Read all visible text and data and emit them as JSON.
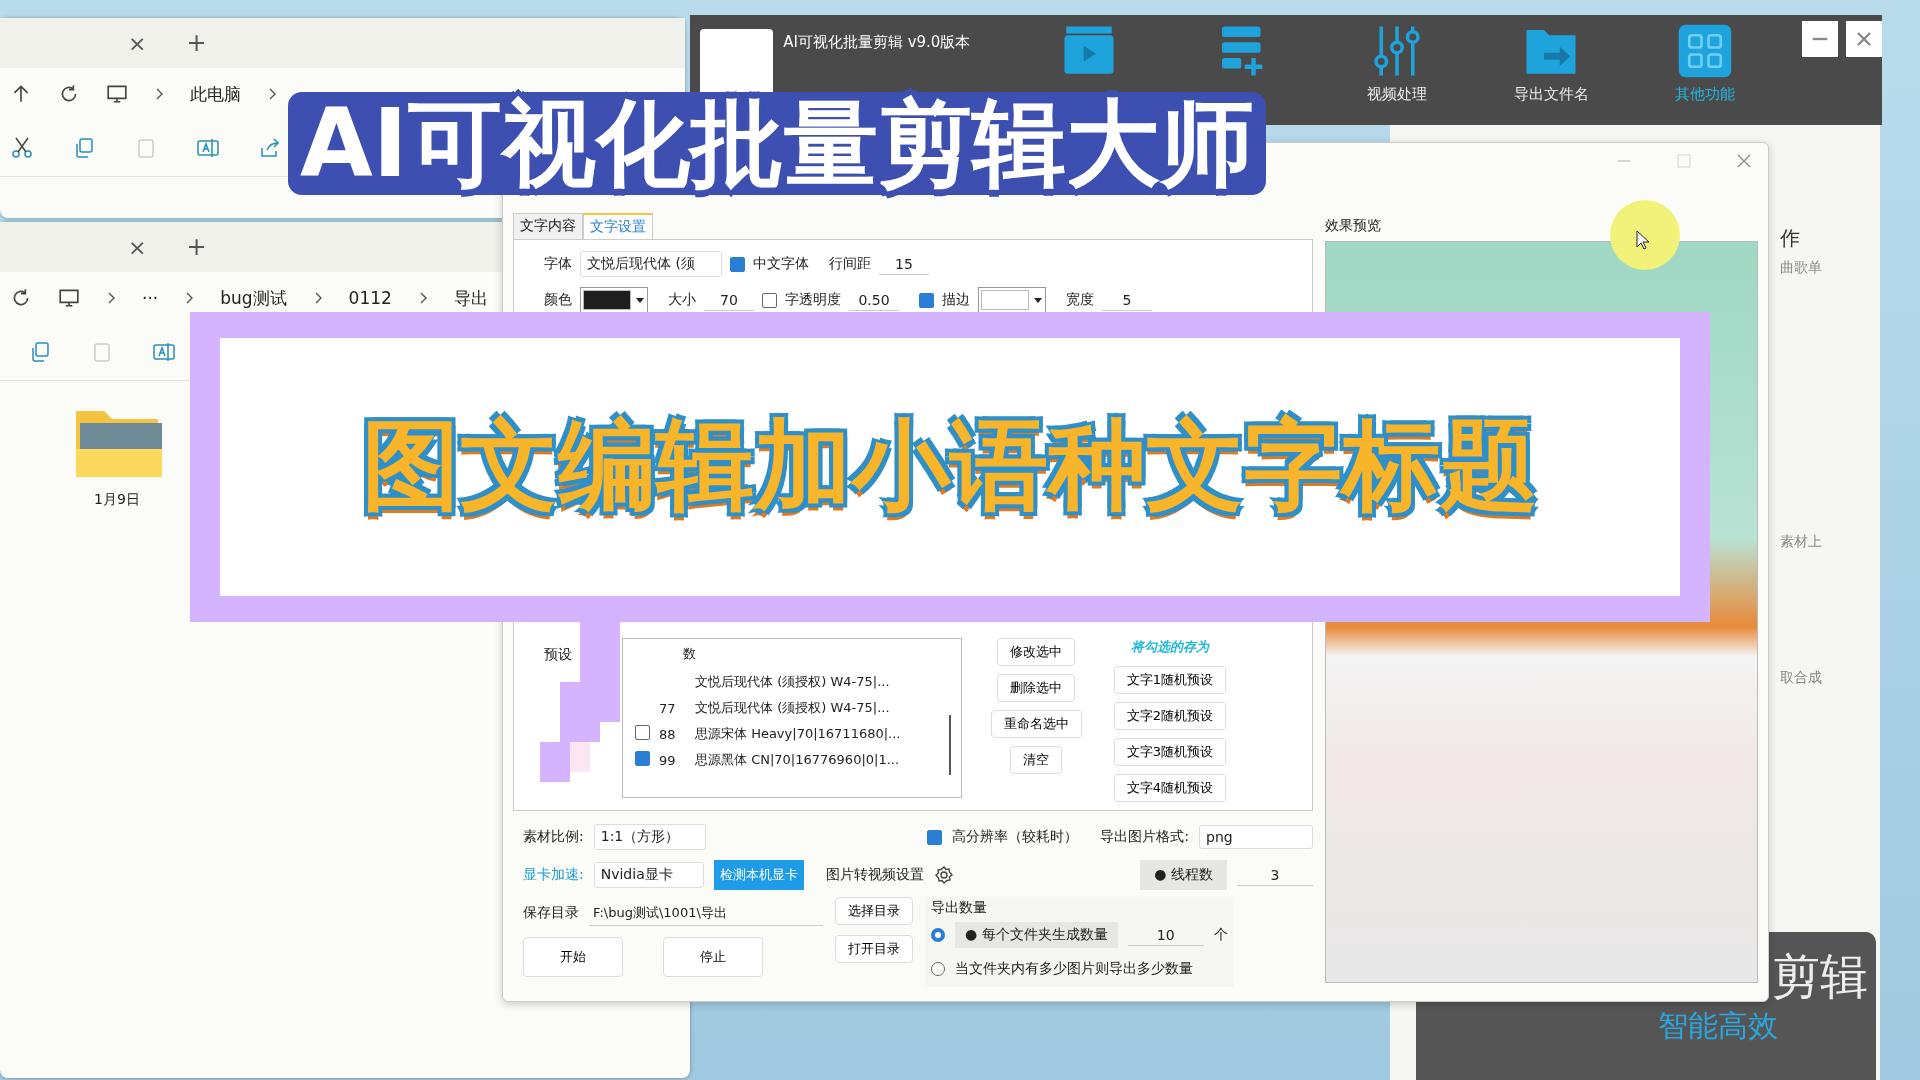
{
  "explorers": [
    {
      "close_tab": "×",
      "new_tab": "+",
      "nav": [
        {
          "kind": "up"
        },
        {
          "kind": "refresh"
        },
        {
          "kind": "pc"
        }
      ],
      "path": [
        "此电脑"
      ],
      "toolbar": [
        {
          "kind": "cut"
        },
        {
          "kind": "copy"
        },
        {
          "kind": "paste"
        },
        {
          "kind": "rename"
        },
        {
          "kind": "share"
        }
      ]
    },
    {
      "close_tab": "×",
      "new_tab": "+",
      "nav": [
        {
          "kind": "refresh"
        },
        {
          "kind": "pc"
        }
      ],
      "path": [
        "···",
        "bug测试",
        "0112",
        "导出"
      ],
      "toolbar": [
        {
          "kind": "copy"
        },
        {
          "kind": "paste"
        },
        {
          "kind": "rename"
        }
      ],
      "items": [
        {
          "label": "1月9日"
        }
      ]
    }
  ],
  "app": {
    "title": "AI可视化批量剪辑 v9.0版本",
    "tools": [
      {
        "kind": "clapper",
        "selected": false
      },
      {
        "kind": "list-add",
        "selected": false
      },
      {
        "kind": "sliders",
        "label": "视频处理",
        "selected": false
      },
      {
        "kind": "folder",
        "label": "导出文件名",
        "selected": false
      },
      {
        "kind": "grid",
        "label": "其他功能",
        "selected": true
      }
    ],
    "side_texts": [
      "作",
      "曲歌单",
      "素材上",
      "取合成"
    ],
    "promo": {
      "title": "剪辑",
      "subtitle": "智能高效"
    }
  },
  "dialog": {
    "tabs": [
      {
        "label": "文字内容",
        "selected": false
      },
      {
        "label": "文字设置",
        "selected": true
      }
    ],
    "font": {
      "label": "字体",
      "value": "文悦后现代体 (须"
    },
    "chinese_font": {
      "label": "中文字体",
      "checked": true
    },
    "line_spacing": {
      "label": "行间距",
      "value": "15"
    },
    "color": {
      "label": "颜色",
      "color": "#1e1e1e"
    },
    "size": {
      "label": "大小",
      "value": "70"
    },
    "opacity": {
      "label": "字透明度",
      "checked": false,
      "value": "0.50"
    },
    "stroke": {
      "label": "描边",
      "checked": true,
      "color": "#ffffff"
    },
    "stroke_width": {
      "label": "宽度",
      "value": "5"
    },
    "presets": {
      "label": "预设",
      "header": "数",
      "rows": [
        {
          "text": "文悦后现代体 (须授权) W4-75|..."
        },
        {
          "num": "77",
          "text": "文悦后现代体 (须授权) W4-75|..."
        },
        {
          "num": "88",
          "text": "思源宋体 Heavy|70|16711680|...",
          "checked": false
        },
        {
          "num": "99",
          "text": "思源黑体 CN|70|16776960|0|1...",
          "checked": true
        }
      ]
    },
    "side_buttons": [
      "修改选中",
      "删除选中",
      "重命名选中",
      "清空"
    ],
    "save_as": {
      "label": "将勾选的存为",
      "buttons": [
        "文字1随机预设",
        "文字2随机预设",
        "文字3随机预设",
        "文字4随机预设"
      ]
    },
    "export": {
      "ratio": {
        "label": "素材比例:",
        "value": "1:1（方形）"
      },
      "hires": {
        "label": "高分辨率（较耗时）",
        "checked": true
      },
      "format": {
        "label": "导出图片格式:",
        "value": "png"
      },
      "gpu": {
        "label": "显卡加速:",
        "value": "Nvidia显卡",
        "detect": "检测本机显卡"
      },
      "img2video": "图片转视频设置",
      "threads": {
        "label": "● 线程数",
        "value": "3"
      },
      "save_dir": {
        "label": "保存目录",
        "value": "F:\\bug测试\\1001\\导出",
        "choose": "选择目录",
        "open": "打开目录"
      },
      "count": {
        "label": "导出数量",
        "options": [
          {
            "label": "● 每个文件夹生成数量",
            "selected": true,
            "value": "10",
            "unit": "个"
          },
          {
            "label": "当文件夹内有多少图片则导出多少数量",
            "selected": false
          }
        ]
      },
      "start": "开始",
      "stop": "停止"
    },
    "preview_label": "效果预览"
  },
  "overlay_title": "AI可视化批量剪辑大师",
  "banner": "图文编辑加小语种文字标题"
}
